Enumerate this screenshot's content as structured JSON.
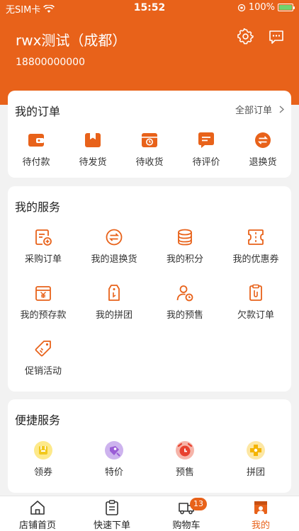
{
  "status_bar": {
    "carrier": "无SIM卡",
    "time": "15:52",
    "battery": "100%"
  },
  "header": {
    "user_name": "rwx测试（成都）",
    "phone": "18800000000"
  },
  "orders": {
    "title": "我的订单",
    "all_link": "全部订单",
    "items": [
      {
        "label": "待付款",
        "icon": "wallet-icon"
      },
      {
        "label": "待发货",
        "icon": "package-icon"
      },
      {
        "label": "待收货",
        "icon": "delivery-icon"
      },
      {
        "label": "待评价",
        "icon": "comment-icon"
      },
      {
        "label": "退换货",
        "icon": "exchange-icon"
      }
    ]
  },
  "services": {
    "title": "我的服务",
    "items": [
      {
        "label": "采购订单",
        "icon": "purchase-order-icon"
      },
      {
        "label": "我的退换货",
        "icon": "exchange-icon"
      },
      {
        "label": "我的积分",
        "icon": "coins-icon"
      },
      {
        "label": "我的优惠券",
        "icon": "coupon-icon"
      },
      {
        "label": "我的预存款",
        "icon": "deposit-icon"
      },
      {
        "label": "我的拼团",
        "icon": "group-tag-icon"
      },
      {
        "label": "我的预售",
        "icon": "presale-user-icon"
      },
      {
        "label": "欠款订单",
        "icon": "debt-order-icon"
      },
      {
        "label": "促销活动",
        "icon": "promo-tag-icon"
      }
    ]
  },
  "quick": {
    "title": "便捷服务",
    "items": [
      {
        "label": "领券",
        "icon": "coupon-bag-icon",
        "color": "#f2c81d"
      },
      {
        "label": "特价",
        "icon": "special-price-icon",
        "color": "#9a5cd6"
      },
      {
        "label": "预售",
        "icon": "alarm-icon",
        "color": "#e8412f"
      },
      {
        "label": "拼团",
        "icon": "puzzle-icon",
        "color": "#f4b400"
      }
    ]
  },
  "tabbar": {
    "items": [
      {
        "label": "店铺首页",
        "icon": "home-icon"
      },
      {
        "label": "快速下单",
        "icon": "clipboard-icon"
      },
      {
        "label": "购物车",
        "icon": "truck-icon",
        "badge": "13"
      },
      {
        "label": "我的",
        "icon": "profile-icon",
        "active": true
      }
    ]
  },
  "colors": {
    "brand": "#e8621a",
    "background": "#f2f2f2"
  }
}
